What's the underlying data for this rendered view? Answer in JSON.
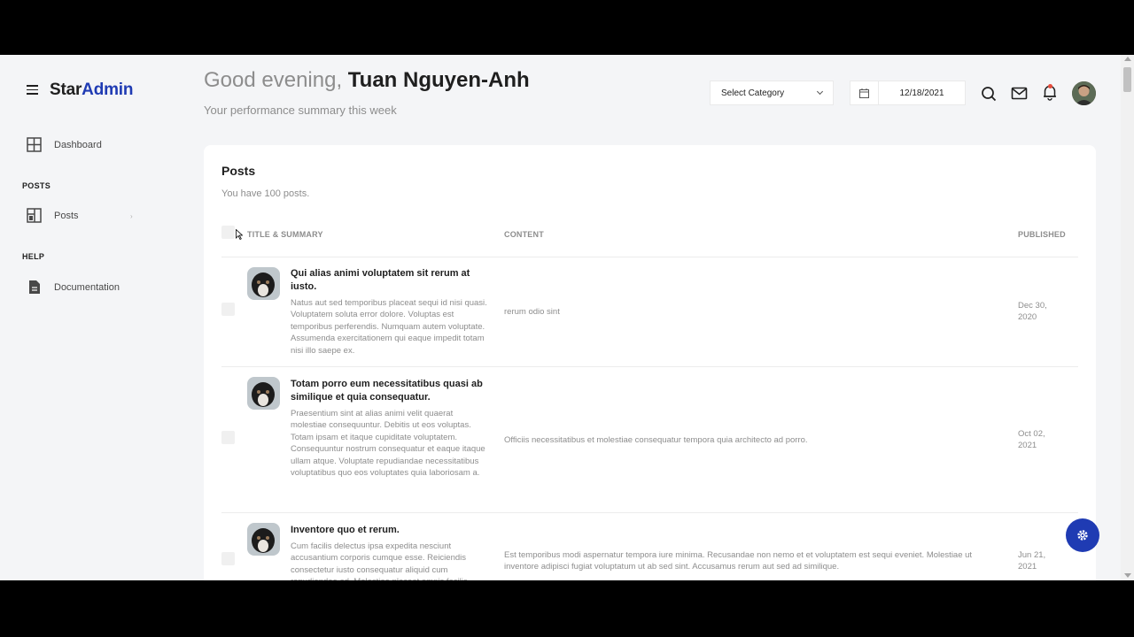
{
  "brand": {
    "part1": "Star",
    "part2": "Admin"
  },
  "sidebar": {
    "items": [
      {
        "label": "Dashboard",
        "icon": "grid-icon"
      },
      {
        "category": "POSTS"
      },
      {
        "label": "Posts",
        "icon": "layout-icon"
      },
      {
        "category": "HELP"
      },
      {
        "label": "Documentation",
        "icon": "document-icon"
      }
    ]
  },
  "header": {
    "greeting_prefix": "Good evening,",
    "user_name": "Tuan Nguyen-Anh",
    "subtitle": "Your performance summary this week",
    "category_select": "Select Category",
    "date": "12/18/2021"
  },
  "card": {
    "title": "Posts",
    "subtitle": "You have 100 posts.",
    "columns": [
      "TITLE & SUMMARY",
      "CONTENT",
      "PUBLISHED"
    ],
    "rows": [
      {
        "title": "Qui alias animi voluptatem sit rerum at iusto.",
        "summary": "Natus aut sed temporibus placeat sequi id nisi quasi. Voluptatem soluta error dolore. Voluptas est temporibus perferendis. Numquam autem voluptate. Assumenda exercitationem qui eaque impedit totam nisi illo saepe ex.",
        "content": "rerum odio sint",
        "published": "Dec 30, 2020"
      },
      {
        "title": "Totam porro eum necessitatibus quasi ab similique et quia consequatur.",
        "summary": "Praesentium sint at alias animi velit quaerat molestiae consequuntur. Debitis ut eos voluptas. Totam ipsam et itaque cupiditate voluptatem. Consequuntur nostrum consequatur et eaque itaque ullam atque. Voluptate repudiandae necessitatibus voluptatibus quo eos voluptates quia laboriosam a.",
        "content": "Officiis necessitatibus et molestiae consequatur tempora quia architecto ad porro.",
        "published": "Oct 02, 2021"
      },
      {
        "title": "Inventore quo et rerum.",
        "summary": "Cum facilis delectus ipsa expedita nesciunt accusantium corporis cumque esse. Reiciendis consectetur iusto consequatur aliquid cum repudiandae ad. Molestiae placeat omnis facilis.",
        "content": "Est temporibus modi aspernatur tempora iure minima. Recusandae non nemo et et voluptatem est sequi eveniet. Molestiae ut inventore adipisci fugiat voluptatum ut ab sed sint. Accusamus rerum aut sed ad similique.",
        "published": "Jun 21, 2021"
      }
    ]
  },
  "colors": {
    "accent": "#1F3BB3",
    "background": "#F4F5F7",
    "notification": "#E74C3C"
  }
}
